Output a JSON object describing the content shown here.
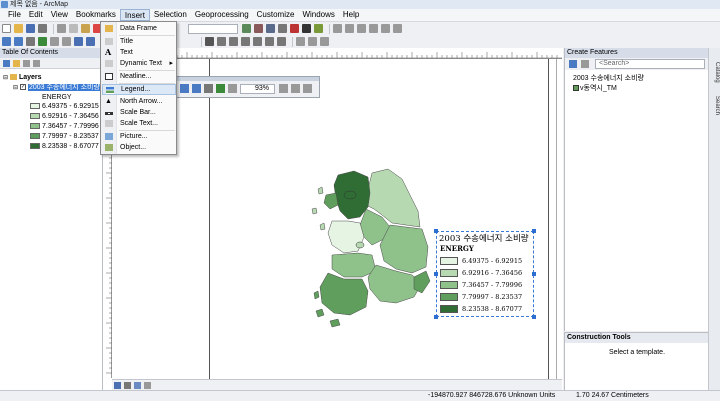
{
  "window": {
    "title": "제목 없음 - ArcMap"
  },
  "menubar": {
    "items": [
      "File",
      "Edit",
      "View",
      "Bookmarks",
      "Insert",
      "Selection",
      "Geoprocessing",
      "Customize",
      "Windows",
      "Help"
    ],
    "active": "Insert"
  },
  "insert_menu": {
    "items": [
      {
        "label": "Data Frame",
        "icon": "data-frame-icon"
      },
      {
        "label": "Title",
        "icon": "title-icon"
      },
      {
        "label": "Text",
        "icon": "text-icon"
      },
      {
        "label": "Dynamic Text",
        "icon": "dynamic-text-icon",
        "submenu_arrow": "▸"
      },
      {
        "label": "Neatline...",
        "icon": "neatline-icon"
      },
      {
        "label": "Legend...",
        "icon": "legend-icon"
      },
      {
        "label": "North Arrow...",
        "icon": "north-arrow-icon"
      },
      {
        "label": "Scale Bar...",
        "icon": "scale-bar-icon"
      },
      {
        "label": "Scale Text...",
        "icon": "scale-text-icon"
      },
      {
        "label": "Picture...",
        "icon": "picture-icon"
      },
      {
        "label": "Object...",
        "icon": "object-icon"
      }
    ]
  },
  "layout_toolbar": {
    "zoom": "93%"
  },
  "toc": {
    "title": "Table Of Contents",
    "root": "Layers",
    "layer": "2003 수송에너지 소비량",
    "field": "ENERGY",
    "classes": [
      {
        "label": "6.49375 - 6.92915",
        "color": "#e5f4e3"
      },
      {
        "label": "6.92916 - 7.36456",
        "color": "#b7d9b2"
      },
      {
        "label": "7.36457 - 7.79996",
        "color": "#8fc18b"
      },
      {
        "label": "7.79997 - 8.23537",
        "color": "#5f9e5c"
      },
      {
        "label": "8.23538 - 8.67077",
        "color": "#2f6d34"
      }
    ]
  },
  "legend": {
    "title": "2003 수송에너지 소비량",
    "field": "ENERGY",
    "items": [
      "6.49375 - 6.92915",
      "6.92916 - 7.36456",
      "7.36457 - 7.79996",
      "7.79997 - 8.23537",
      "8.23538 - 8.67077"
    ]
  },
  "create_features": {
    "title": "Create Features",
    "search_placeholder": "<Search>",
    "templates": [
      "2003 수송에너지 소비량",
      "v동역시_TM"
    ]
  },
  "construction_tools": {
    "title": "Construction Tools",
    "message": "Select a template."
  },
  "side_tabs": [
    "Catalog",
    "Search"
  ],
  "status": {
    "coords": "-194870.927  846728.676 Unknown Units",
    "page": "1.70  24.67 Centimeters"
  },
  "colors": {
    "accent": "#3a7bd5",
    "dark_green": "#2f6d34"
  }
}
